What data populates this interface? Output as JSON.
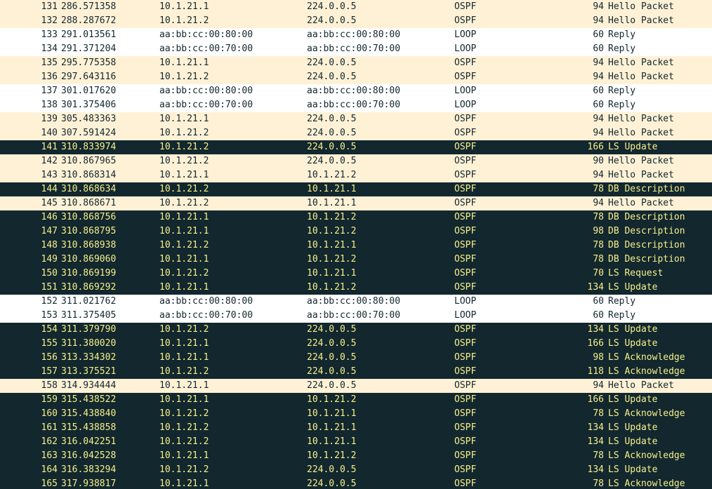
{
  "colors": {
    "ospf_row_bg": "#fff1d6",
    "loop_row_bg": "#ffffff",
    "bad_row_bg": "#12272e",
    "bad_row_fg": "#f7f08b",
    "normal_fg": "#12272e"
  },
  "packets": [
    {
      "no": "131",
      "time": "286.571358",
      "src": "10.1.21.1",
      "dst": "224.0.0.5",
      "proto": "OSPF",
      "len": "94",
      "info": "Hello Packet",
      "style": "ospf"
    },
    {
      "no": "132",
      "time": "288.287672",
      "src": "10.1.21.2",
      "dst": "224.0.0.5",
      "proto": "OSPF",
      "len": "94",
      "info": "Hello Packet",
      "style": "ospf"
    },
    {
      "no": "133",
      "time": "291.013561",
      "src": "aa:bb:cc:00:80:00",
      "dst": "aa:bb:cc:00:80:00",
      "proto": "LOOP",
      "len": "60",
      "info": "Reply",
      "style": "loop"
    },
    {
      "no": "134",
      "time": "291.371204",
      "src": "aa:bb:cc:00:70:00",
      "dst": "aa:bb:cc:00:70:00",
      "proto": "LOOP",
      "len": "60",
      "info": "Reply",
      "style": "loop"
    },
    {
      "no": "135",
      "time": "295.775358",
      "src": "10.1.21.1",
      "dst": "224.0.0.5",
      "proto": "OSPF",
      "len": "94",
      "info": "Hello Packet",
      "style": "ospf"
    },
    {
      "no": "136",
      "time": "297.643116",
      "src": "10.1.21.2",
      "dst": "224.0.0.5",
      "proto": "OSPF",
      "len": "94",
      "info": "Hello Packet",
      "style": "ospf"
    },
    {
      "no": "137",
      "time": "301.017620",
      "src": "aa:bb:cc:00:80:00",
      "dst": "aa:bb:cc:00:80:00",
      "proto": "LOOP",
      "len": "60",
      "info": "Reply",
      "style": "loop"
    },
    {
      "no": "138",
      "time": "301.375406",
      "src": "aa:bb:cc:00:70:00",
      "dst": "aa:bb:cc:00:70:00",
      "proto": "LOOP",
      "len": "60",
      "info": "Reply",
      "style": "loop"
    },
    {
      "no": "139",
      "time": "305.483363",
      "src": "10.1.21.1",
      "dst": "224.0.0.5",
      "proto": "OSPF",
      "len": "94",
      "info": "Hello Packet",
      "style": "ospf"
    },
    {
      "no": "140",
      "time": "307.591424",
      "src": "10.1.21.2",
      "dst": "224.0.0.5",
      "proto": "OSPF",
      "len": "94",
      "info": "Hello Packet",
      "style": "ospf"
    },
    {
      "no": "141",
      "time": "310.833974",
      "src": "10.1.21.2",
      "dst": "224.0.0.5",
      "proto": "OSPF",
      "len": "166",
      "info": "LS Update",
      "style": "dark"
    },
    {
      "no": "142",
      "time": "310.867965",
      "src": "10.1.21.2",
      "dst": "224.0.0.5",
      "proto": "OSPF",
      "len": "90",
      "info": "Hello Packet",
      "style": "ospf"
    },
    {
      "no": "143",
      "time": "310.868314",
      "src": "10.1.21.1",
      "dst": "10.1.21.2",
      "proto": "OSPF",
      "len": "94",
      "info": "Hello Packet",
      "style": "ospf"
    },
    {
      "no": "144",
      "time": "310.868634",
      "src": "10.1.21.2",
      "dst": "10.1.21.1",
      "proto": "OSPF",
      "len": "78",
      "info": "DB Description",
      "style": "dark"
    },
    {
      "no": "145",
      "time": "310.868671",
      "src": "10.1.21.2",
      "dst": "10.1.21.1",
      "proto": "OSPF",
      "len": "94",
      "info": "Hello Packet",
      "style": "ospf"
    },
    {
      "no": "146",
      "time": "310.868756",
      "src": "10.1.21.1",
      "dst": "10.1.21.2",
      "proto": "OSPF",
      "len": "78",
      "info": "DB Description",
      "style": "dark"
    },
    {
      "no": "147",
      "time": "310.868795",
      "src": "10.1.21.1",
      "dst": "10.1.21.2",
      "proto": "OSPF",
      "len": "98",
      "info": "DB Description",
      "style": "dark"
    },
    {
      "no": "148",
      "time": "310.868938",
      "src": "10.1.21.2",
      "dst": "10.1.21.1",
      "proto": "OSPF",
      "len": "78",
      "info": "DB Description",
      "style": "dark"
    },
    {
      "no": "149",
      "time": "310.869060",
      "src": "10.1.21.1",
      "dst": "10.1.21.2",
      "proto": "OSPF",
      "len": "78",
      "info": "DB Description",
      "style": "dark"
    },
    {
      "no": "150",
      "time": "310.869199",
      "src": "10.1.21.2",
      "dst": "10.1.21.1",
      "proto": "OSPF",
      "len": "70",
      "info": "LS Request",
      "style": "dark"
    },
    {
      "no": "151",
      "time": "310.869292",
      "src": "10.1.21.1",
      "dst": "10.1.21.2",
      "proto": "OSPF",
      "len": "134",
      "info": "LS Update",
      "style": "dark"
    },
    {
      "no": "152",
      "time": "311.021762",
      "src": "aa:bb:cc:00:80:00",
      "dst": "aa:bb:cc:00:80:00",
      "proto": "LOOP",
      "len": "60",
      "info": "Reply",
      "style": "loop"
    },
    {
      "no": "153",
      "time": "311.375405",
      "src": "aa:bb:cc:00:70:00",
      "dst": "aa:bb:cc:00:70:00",
      "proto": "LOOP",
      "len": "60",
      "info": "Reply",
      "style": "loop"
    },
    {
      "no": "154",
      "time": "311.379790",
      "src": "10.1.21.2",
      "dst": "224.0.0.5",
      "proto": "OSPF",
      "len": "134",
      "info": "LS Update",
      "style": "dark"
    },
    {
      "no": "155",
      "time": "311.380020",
      "src": "10.1.21.1",
      "dst": "224.0.0.5",
      "proto": "OSPF",
      "len": "166",
      "info": "LS Update",
      "style": "dark"
    },
    {
      "no": "156",
      "time": "313.334302",
      "src": "10.1.21.1",
      "dst": "224.0.0.5",
      "proto": "OSPF",
      "len": "98",
      "info": "LS Acknowledge",
      "style": "dark"
    },
    {
      "no": "157",
      "time": "313.375521",
      "src": "10.1.21.2",
      "dst": "224.0.0.5",
      "proto": "OSPF",
      "len": "118",
      "info": "LS Acknowledge",
      "style": "dark"
    },
    {
      "no": "158",
      "time": "314.934444",
      "src": "10.1.21.1",
      "dst": "224.0.0.5",
      "proto": "OSPF",
      "len": "94",
      "info": "Hello Packet",
      "style": "ospf"
    },
    {
      "no": "159",
      "time": "315.438522",
      "src": "10.1.21.1",
      "dst": "10.1.21.2",
      "proto": "OSPF",
      "len": "166",
      "info": "LS Update",
      "style": "dark"
    },
    {
      "no": "160",
      "time": "315.438840",
      "src": "10.1.21.2",
      "dst": "10.1.21.1",
      "proto": "OSPF",
      "len": "78",
      "info": "LS Acknowledge",
      "style": "dark"
    },
    {
      "no": "161",
      "time": "315.438858",
      "src": "10.1.21.2",
      "dst": "10.1.21.1",
      "proto": "OSPF",
      "len": "134",
      "info": "LS Update",
      "style": "dark"
    },
    {
      "no": "162",
      "time": "316.042251",
      "src": "10.1.21.2",
      "dst": "10.1.21.1",
      "proto": "OSPF",
      "len": "134",
      "info": "LS Update",
      "style": "dark"
    },
    {
      "no": "163",
      "time": "316.042528",
      "src": "10.1.21.1",
      "dst": "10.1.21.2",
      "proto": "OSPF",
      "len": "78",
      "info": "LS Acknowledge",
      "style": "dark"
    },
    {
      "no": "164",
      "time": "316.383294",
      "src": "10.1.21.2",
      "dst": "224.0.0.5",
      "proto": "OSPF",
      "len": "134",
      "info": "LS Update",
      "style": "dark"
    },
    {
      "no": "165",
      "time": "317.938817",
      "src": "10.1.21.1",
      "dst": "224.0.0.5",
      "proto": "OSPF",
      "len": "78",
      "info": "LS Acknowledge",
      "style": "dark"
    }
  ]
}
